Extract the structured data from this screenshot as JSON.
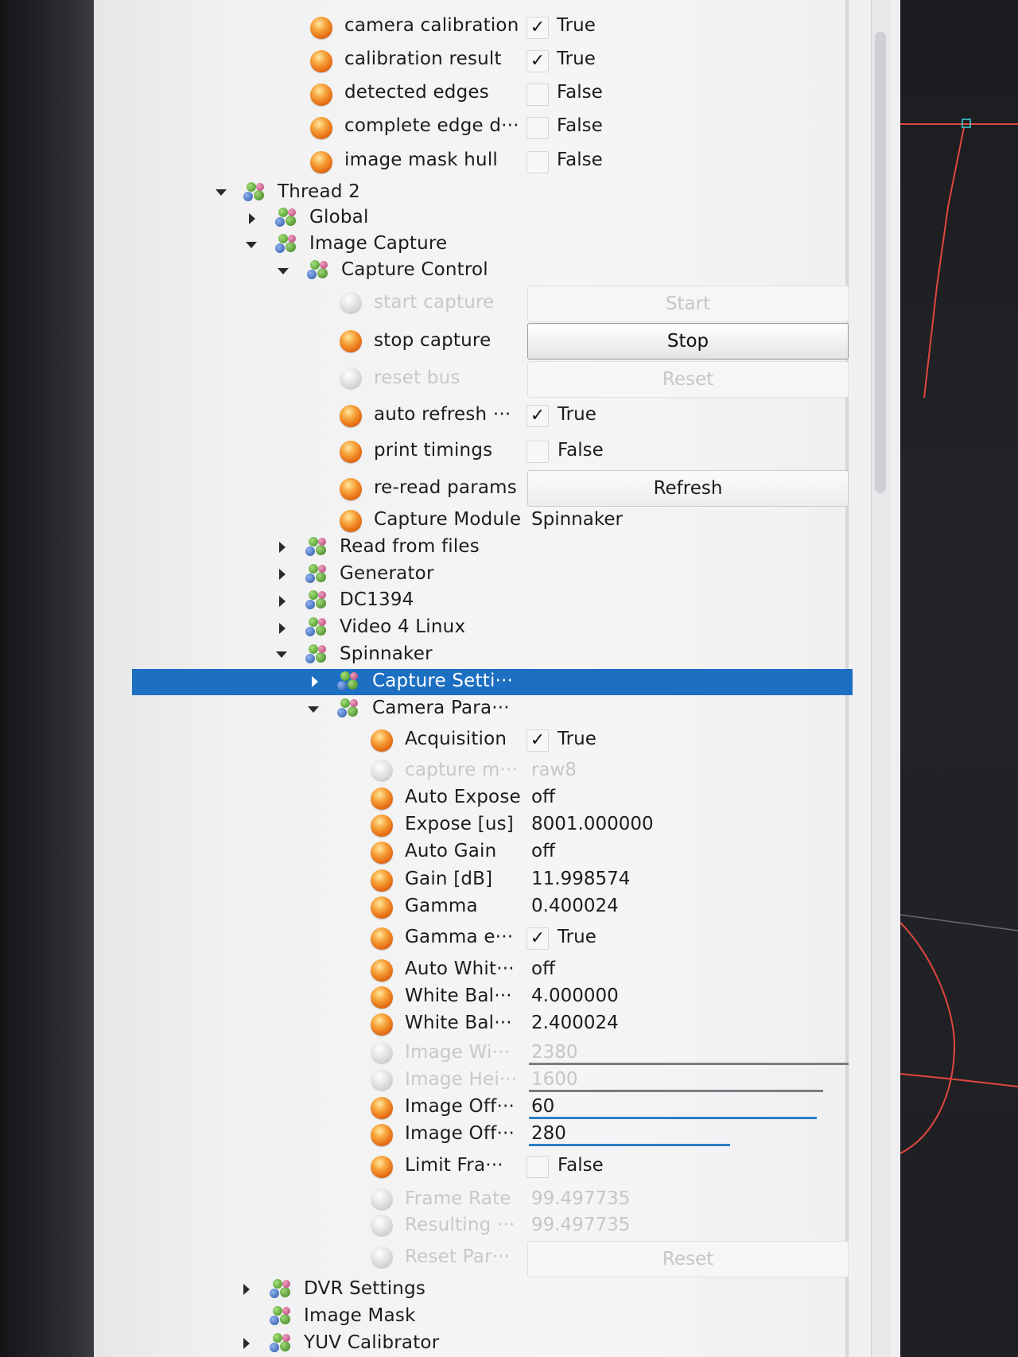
{
  "top_rows": [
    {
      "label": "camera calibration",
      "checked": true,
      "value": "True"
    },
    {
      "label": "calibration result",
      "checked": true,
      "value": "True"
    },
    {
      "label": "detected edges",
      "checked": false,
      "value": "False"
    },
    {
      "label": "complete edge d···",
      "checked": false,
      "value": "False"
    },
    {
      "label": "image mask hull",
      "checked": false,
      "value": "False"
    }
  ],
  "tree": {
    "thread2": "Thread 2",
    "global": "Global",
    "image_capture": "Image Capture",
    "capture_control": "Capture Control",
    "read_from_files": "Read from files",
    "generator": "Generator",
    "dc1394": "DC1394",
    "video4linux": "Video 4 Linux",
    "spinnaker": "Spinnaker",
    "capture_settings": "Capture Setti···",
    "camera_params": "Camera Para···",
    "dvr_settings": "DVR Settings",
    "image_mask": "Image Mask",
    "yuv_calibrator": "YUV Calibrator"
  },
  "capture_control": {
    "start_capture": {
      "label": "start capture",
      "button": "Start"
    },
    "stop_capture": {
      "label": "stop capture",
      "button": "Stop"
    },
    "reset_bus": {
      "label": "reset bus",
      "button": "Reset"
    },
    "auto_refresh": {
      "label": "auto refresh ···",
      "checked": true,
      "value": "True"
    },
    "print_timings": {
      "label": "print timings",
      "checked": false,
      "value": "False"
    },
    "reread_params": {
      "label": "re-read params",
      "button": "Refresh"
    },
    "capture_module": {
      "label": "Capture Module",
      "value": "Spinnaker"
    }
  },
  "camera_params": {
    "acquisition": {
      "label": "Acquisition",
      "checked": true,
      "value": "True"
    },
    "capture_mode": {
      "label": "capture m···",
      "value": "raw8"
    },
    "auto_expose": {
      "label": "Auto Expose",
      "value": "off"
    },
    "expose_us": {
      "label": "Expose [us]",
      "value": "8001.000000"
    },
    "auto_gain": {
      "label": "Auto Gain",
      "value": "off"
    },
    "gain_db": {
      "label": "Gain [dB]",
      "value": "11.998574"
    },
    "gamma": {
      "label": "Gamma",
      "value": "0.400024"
    },
    "gamma_enabled": {
      "label": "Gamma e···",
      "checked": true,
      "value": "True"
    },
    "auto_white": {
      "label": "Auto Whit···",
      "value": "off"
    },
    "white_bal_1": {
      "label": "White Bal···",
      "value": "4.000000"
    },
    "white_bal_2": {
      "label": "White Bal···",
      "value": "2.400024"
    },
    "image_width": {
      "label": "Image Wi···",
      "value": "2380",
      "slider_fraction": 1.0
    },
    "image_height": {
      "label": "Image Hei···",
      "value": "1600",
      "slider_fraction": 0.92
    },
    "image_offset_x": {
      "label": "Image Off···",
      "value": "60",
      "slider_fraction": 0.9
    },
    "image_offset_y": {
      "label": "Image Off···",
      "value": "280",
      "slider_fraction": 0.63
    },
    "limit_frame": {
      "label": "Limit Fra···",
      "checked": false,
      "value": "False"
    },
    "frame_rate": {
      "label": "Frame Rate",
      "value": "99.497735"
    },
    "resulting": {
      "label": "Resulting ···",
      "value": "99.497735"
    },
    "reset_params": {
      "label": "Reset Par···",
      "button": "Reset"
    }
  },
  "colors": {
    "selection": "#1d6fc2",
    "accent_slider": "#2c7fc4",
    "trace": "#e0463f"
  }
}
